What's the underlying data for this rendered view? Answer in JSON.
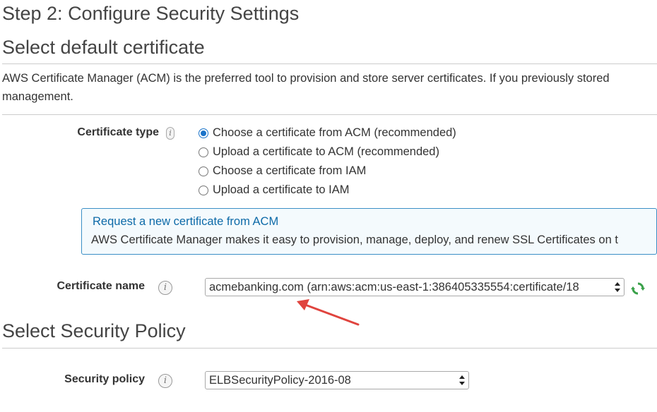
{
  "page": {
    "step_title": "Step 2: Configure Security Settings",
    "section_certificate": "Select default certificate",
    "description_line1": "AWS Certificate Manager (ACM) is the preferred tool to provision and store server certificates. If you previously stored",
    "description_line2": "management.",
    "section_policy": "Select Security Policy"
  },
  "certificate_type": {
    "label": "Certificate type",
    "options": [
      {
        "label": "Choose a certificate from ACM (recommended)",
        "checked": true
      },
      {
        "label": "Upload a certificate to ACM (recommended)",
        "checked": false
      },
      {
        "label": "Choose a certificate from IAM",
        "checked": false
      },
      {
        "label": "Upload a certificate to IAM",
        "checked": false
      }
    ]
  },
  "acm_box": {
    "link": "Request a new certificate from ACM",
    "text": "AWS Certificate Manager makes it easy to provision, manage, deploy, and renew SSL Certificates on t"
  },
  "certificate_name": {
    "label": "Certificate name",
    "value": "acmebanking.com (arn:aws:acm:us-east-1:386405335554:certificate/18"
  },
  "security_policy": {
    "label": "Security policy",
    "value": "ELBSecurityPolicy-2016-08"
  },
  "colors": {
    "accent": "#1a73c9",
    "link": "#0d6aa8",
    "info_border": "#3b8fc6",
    "annotation_arrow": "#e0443e",
    "refresh_green": "#3aa14a"
  }
}
